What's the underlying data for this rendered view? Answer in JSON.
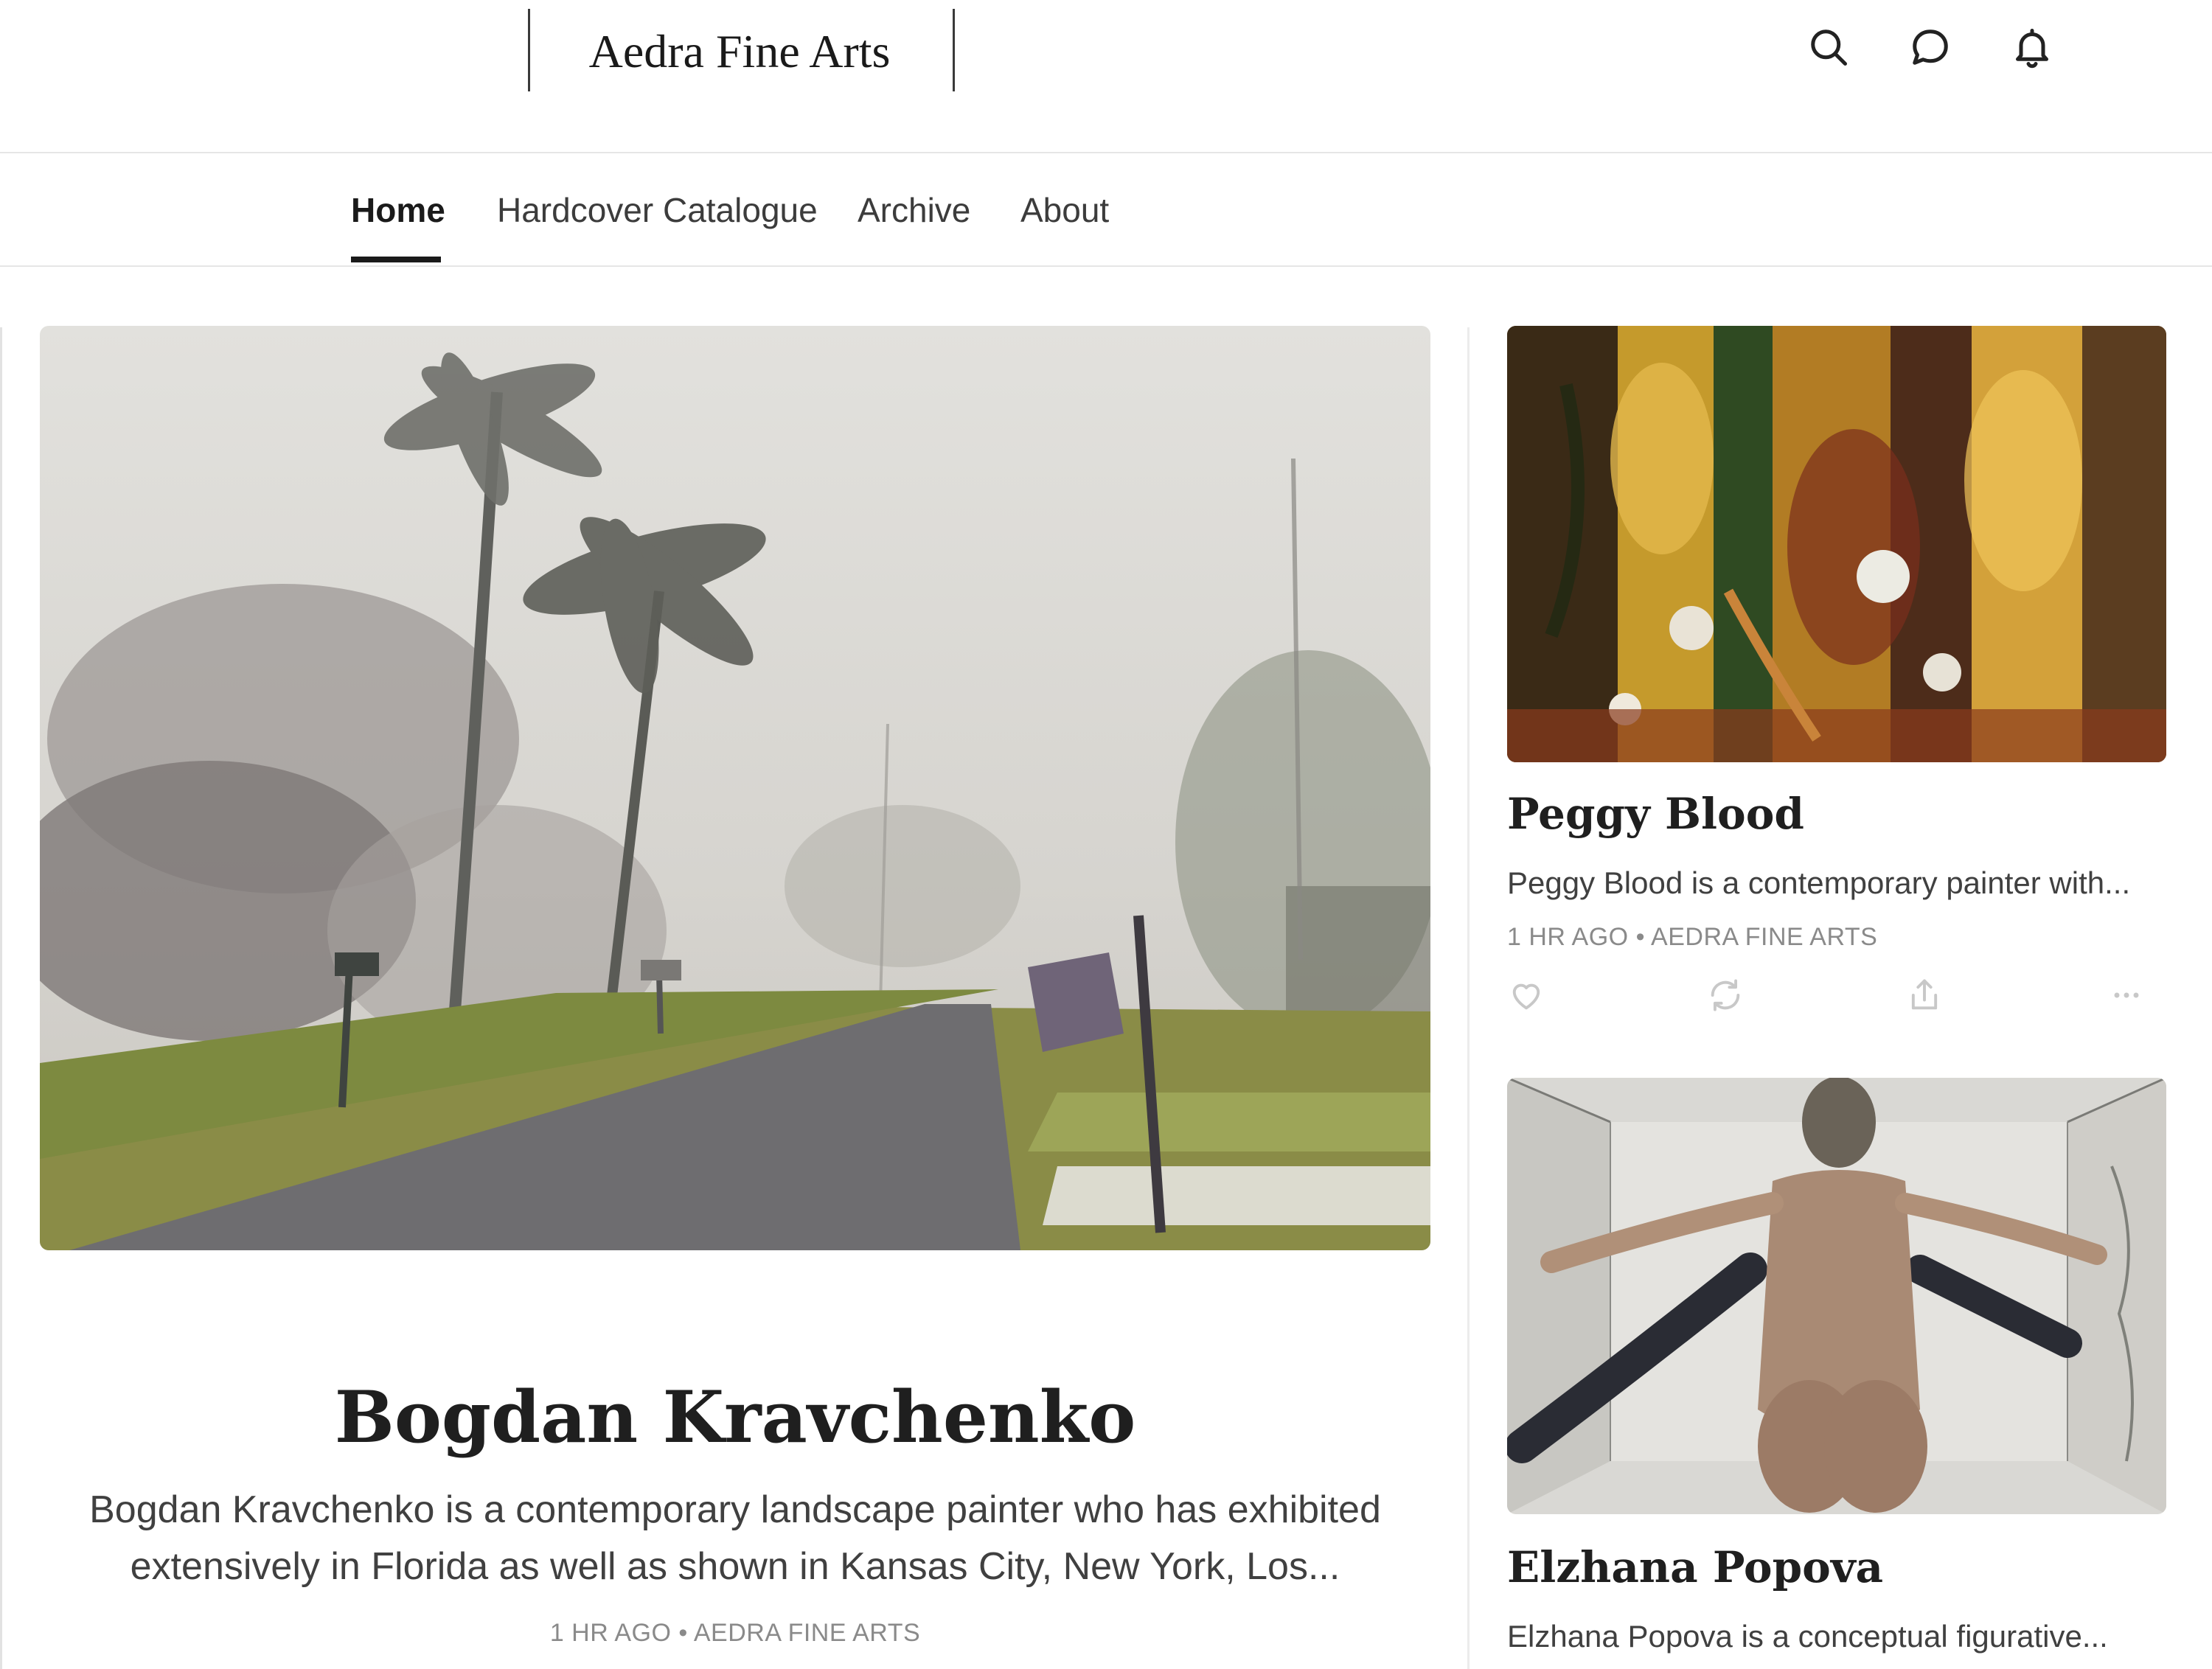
{
  "header": {
    "publication_title": "Aedra Fine Arts",
    "icons": [
      "search-icon",
      "chat-icon",
      "bell-icon"
    ]
  },
  "nav": {
    "items": [
      {
        "label": "Home",
        "active": true
      },
      {
        "label": "Hardcover Catalogue",
        "active": false
      },
      {
        "label": "Archive",
        "active": false
      },
      {
        "label": "About",
        "active": false
      }
    ]
  },
  "featured": {
    "title": "Bogdan Kravchenko",
    "subtitle_line1": "Bogdan Kravchenko is a contemporary landscape painter who has exhibited",
    "subtitle_line2": "extensively in Florida as well as shown in Kansas City, New York, Los...",
    "time": "1 HR AGO",
    "author": "AEDRA FINE ARTS",
    "separator": "•"
  },
  "posts": [
    {
      "title": "Peggy Blood",
      "subtitle": "Peggy Blood is a contemporary painter with...",
      "time": "1 HR AGO",
      "author": "AEDRA FINE ARTS",
      "separator": "•",
      "actions": [
        "heart-icon",
        "restack-icon",
        "share-icon",
        "more-icon"
      ]
    },
    {
      "title": "Elzhana Popova",
      "subtitle": "Elzhana Popova is a conceptual figurative..."
    }
  ],
  "colors": {
    "text": "#1f1f1f",
    "meta": "#8a8a8a",
    "divider": "#e6e6e6"
  }
}
